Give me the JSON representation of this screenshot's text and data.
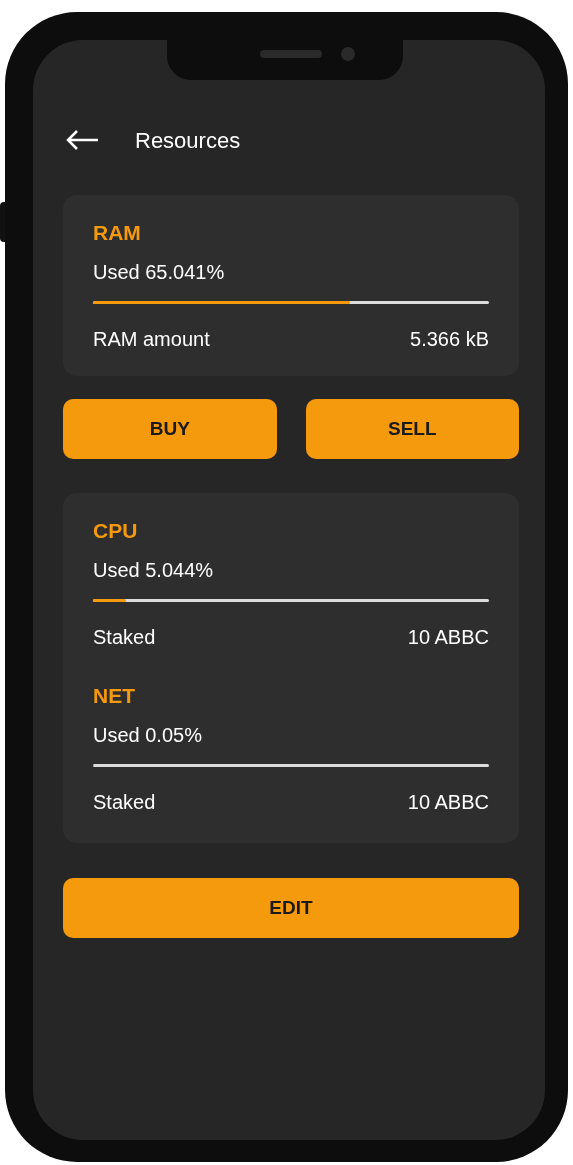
{
  "header": {
    "title": "Resources"
  },
  "ram_card": {
    "groups": [
      {
        "title": "RAM",
        "usage": "Used 65.041%",
        "level": 0.65,
        "label": "RAM amount",
        "value": "5.366 kB"
      }
    ]
  },
  "trade_buttons": [
    "BUY",
    "SELL"
  ],
  "cpu_net_card": {
    "groups": [
      {
        "title": "CPU",
        "usage": "Used 5.044%",
        "level": 0.084,
        "label": "Staked",
        "value": "10 ABBC"
      },
      {
        "title": "NET",
        "usage": "Used 0.05%",
        "level": 0.0005,
        "label": "Staked",
        "value": "10 ABBC"
      }
    ]
  },
  "edit_button": "EDIT"
}
